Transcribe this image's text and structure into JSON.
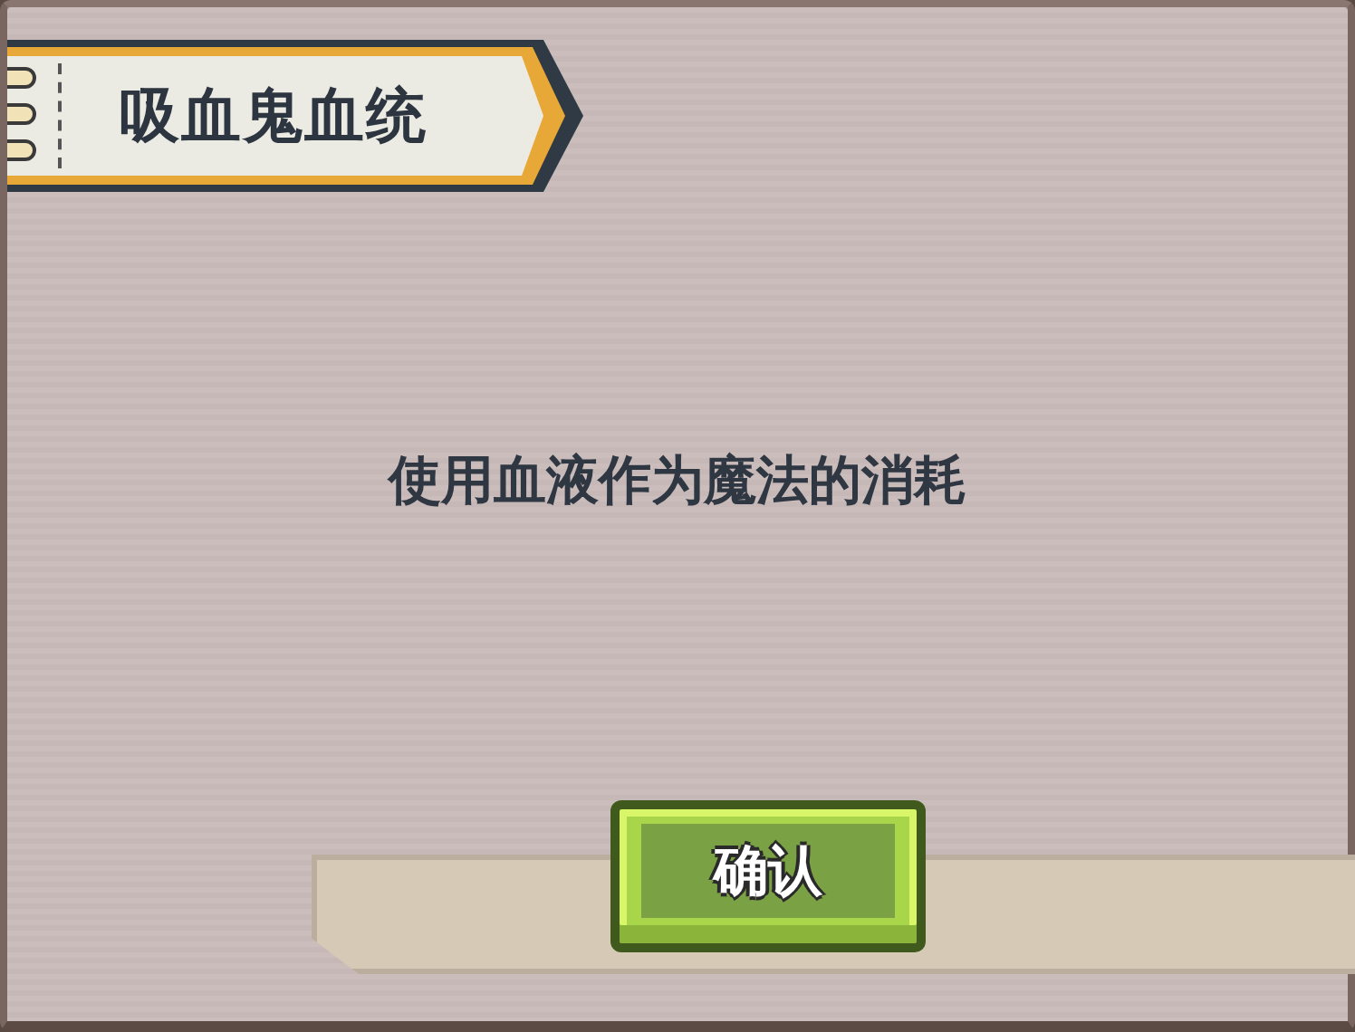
{
  "title": "吸血鬼血统",
  "message": "使用血液作为魔法的消耗",
  "buttons": [
    "确认"
  ]
}
